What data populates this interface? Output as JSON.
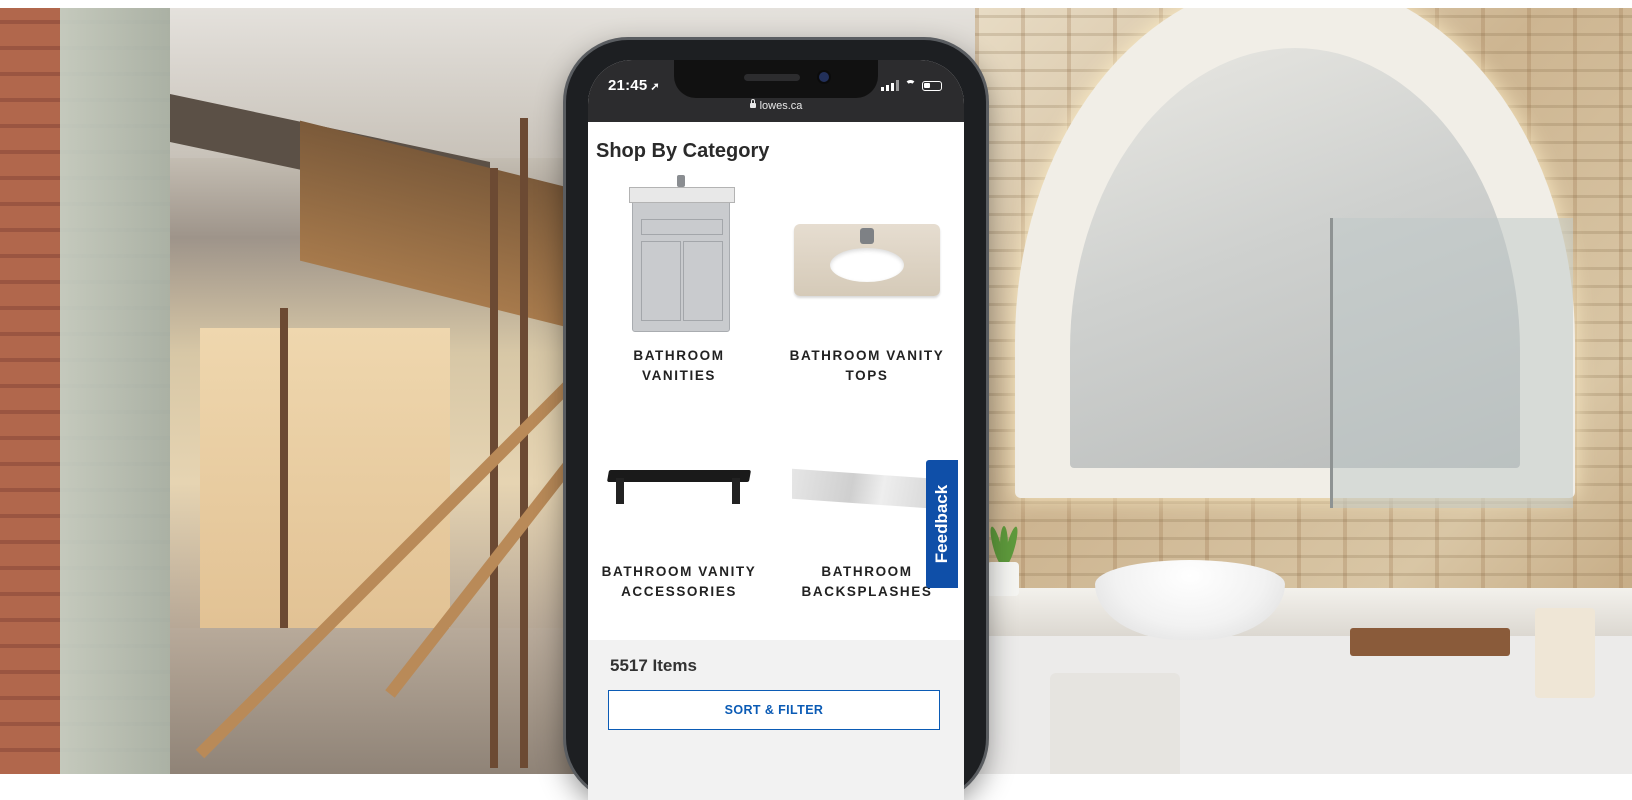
{
  "status_bar": {
    "time": "21:45",
    "url": "lowes.ca"
  },
  "page": {
    "section_title": "Shop By Category",
    "categories": [
      {
        "label": "BATHROOM\nVANITIES",
        "icon": "bathroom-vanity-image"
      },
      {
        "label": "BATHROOM VANITY\nTOPS",
        "icon": "vanity-top-image"
      },
      {
        "label": "BATHROOM VANITY\nACCESSORIES",
        "icon": "vanity-accessory-image"
      },
      {
        "label": "BATHROOM\nBACKSPLASHES",
        "icon": "backsplash-image"
      }
    ],
    "feedback_label": "Feedback",
    "items_count": "5517 Items",
    "sort_filter_label": "SORT & FILTER"
  },
  "colors": {
    "brand_blue": "#0f4fa8",
    "button_blue": "#0b5bb5",
    "status_bar": "#2c2c2e"
  }
}
